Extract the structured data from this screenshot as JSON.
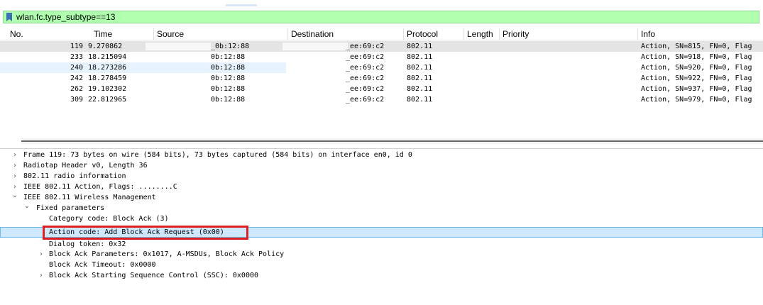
{
  "filter": {
    "value": "wlan.fc.type_subtype==13"
  },
  "columns": [
    "No.",
    "Time",
    "Source",
    "Destination",
    "Protocol",
    "Length",
    "Priority",
    "Info"
  ],
  "packets": [
    {
      "no": "119",
      "time": "9.270862",
      "source": "_0b:12:88",
      "destination": "_ee:69:c2",
      "protocol": "802.11",
      "info": "Action, SN=815, FN=0, Flag"
    },
    {
      "no": "233",
      "time": "18.215094",
      "source": "0b:12:88",
      "destination": "_ee:69:c2",
      "protocol": "802.11",
      "info": "Action, SN=918, FN=0, Flag"
    },
    {
      "no": "240",
      "time": "18.273286",
      "source": "0b:12:88",
      "destination": "_ee:69:c2",
      "protocol": "802.11",
      "info": "Action, SN=920, FN=0, Flag"
    },
    {
      "no": "242",
      "time": "18.278459",
      "source": "0b:12:88",
      "destination": "_ee:69:c2",
      "protocol": "802.11",
      "info": "Action, SN=922, FN=0, Flag"
    },
    {
      "no": "262",
      "time": "19.102302",
      "source": "0b:12:88",
      "destination": "_ee:69:c2",
      "protocol": "802.11",
      "info": "Action, SN=937, FN=0, Flag"
    },
    {
      "no": "309",
      "time": "22.812965",
      "source": "0b:12:88",
      "destination": "_ee:69:c2",
      "protocol": "802.11",
      "info": "Action, SN=979, FN=0, Flag"
    }
  ],
  "details": [
    {
      "arrow": "›",
      "text": "Frame 119: 73 bytes on wire (584 bits), 73 bytes captured (584 bits) on interface en0, id 0"
    },
    {
      "arrow": "›",
      "text": "Radiotap Header v0, Length 36"
    },
    {
      "arrow": "›",
      "text": "802.11 radio information"
    },
    {
      "arrow": "›",
      "text": "IEEE 802.11 Action, Flags: ........C"
    },
    {
      "arrow": "⌄",
      "text": "IEEE 802.11 Wireless Management"
    },
    {
      "arrow": "⌄",
      "text": "Fixed parameters"
    },
    {
      "arrow": "",
      "text": "Category code: Block Ack (3)"
    },
    {
      "arrow": "",
      "text": "Action code: Add Block Ack Request (0x00)"
    },
    {
      "arrow": "",
      "text": "Dialog token: 0x32"
    },
    {
      "arrow": "›",
      "text": "Block Ack Parameters: 0x1017, A-MSDUs, Block Ack Policy"
    },
    {
      "arrow": "",
      "text": "Block Ack Timeout: 0x0000"
    },
    {
      "arrow": "›",
      "text": "Block Ack Starting Sequence Control (SSC): 0x0000"
    }
  ],
  "colors": {
    "filter_bg": "#afffaf",
    "selection": "#cde8ff",
    "highlight_box": "#e02020"
  }
}
